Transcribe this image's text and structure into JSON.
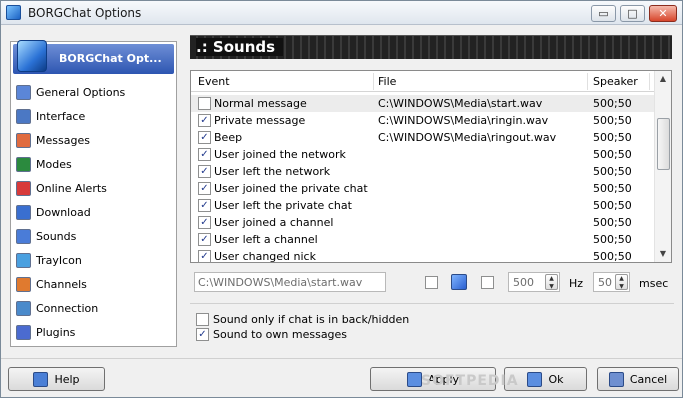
{
  "window": {
    "title": "BORGChat Options",
    "minimize": "▭",
    "maximize": "□",
    "close": "✕"
  },
  "sidebar": {
    "header": "BORGChat Opt...",
    "items": [
      {
        "label": "General Options",
        "icon": "gear-icon",
        "color": "#5b86d8"
      },
      {
        "label": "Interface",
        "icon": "window-icon",
        "color": "#4b78c4"
      },
      {
        "label": "Messages",
        "icon": "messages-icon",
        "color": "#e06b3f"
      },
      {
        "label": "Modes",
        "icon": "modes-icon",
        "color": "#2b8a3e"
      },
      {
        "label": "Online Alerts",
        "icon": "alert-icon",
        "color": "#d83a3a"
      },
      {
        "label": "Download",
        "icon": "download-icon",
        "color": "#3a6fd0"
      },
      {
        "label": "Sounds",
        "icon": "speaker-icon",
        "color": "#4a7cd8"
      },
      {
        "label": "TrayIcon",
        "icon": "tray-icon",
        "color": "#4aa0e0"
      },
      {
        "label": "Channels",
        "icon": "channels-icon",
        "color": "#e07a2f"
      },
      {
        "label": "Connection",
        "icon": "connection-icon",
        "color": "#4a8acb"
      },
      {
        "label": "Plugins",
        "icon": "plugins-icon",
        "color": "#4b6bd0"
      }
    ]
  },
  "banner": {
    "title": ".: Sounds"
  },
  "table": {
    "headers": {
      "event": "Event",
      "file": "File",
      "speaker": "Speaker"
    },
    "rows": [
      {
        "checked": false,
        "event": "Normal message",
        "file": "C:\\WINDOWS\\Media\\start.wav",
        "speaker": "500;50",
        "selected": true
      },
      {
        "checked": true,
        "event": "Private message",
        "file": "C:\\WINDOWS\\Media\\ringin.wav",
        "speaker": "500;50"
      },
      {
        "checked": true,
        "event": "Beep",
        "file": "C:\\WINDOWS\\Media\\ringout.wav",
        "speaker": "500;50"
      },
      {
        "checked": true,
        "event": "User joined the network",
        "file": "",
        "speaker": "500;50"
      },
      {
        "checked": true,
        "event": "User left the network",
        "file": "",
        "speaker": "500;50"
      },
      {
        "checked": true,
        "event": "User joined the private chat",
        "file": "",
        "speaker": "500;50"
      },
      {
        "checked": true,
        "event": "User left the private chat",
        "file": "",
        "speaker": "500;50"
      },
      {
        "checked": true,
        "event": "User joined a channel",
        "file": "",
        "speaker": "500;50"
      },
      {
        "checked": true,
        "event": "User left a channel",
        "file": "",
        "speaker": "500;50"
      },
      {
        "checked": true,
        "event": "User changed nick",
        "file": "",
        "speaker": "500;50"
      }
    ]
  },
  "controls": {
    "path_value": "C:\\WINDOWS\\Media\\start.wav",
    "hz_value": "500",
    "hz_unit": "Hz",
    "msec_value": "50",
    "msec_unit": "msec"
  },
  "options": {
    "sound_only_back": "Sound only if chat is in back/hidden",
    "sound_own": "Sound to own messages"
  },
  "buttons": {
    "help": "Help",
    "apply": "Apply",
    "ok": "Ok",
    "cancel": "Cancel"
  },
  "watermark": "SOFTPEDIA"
}
